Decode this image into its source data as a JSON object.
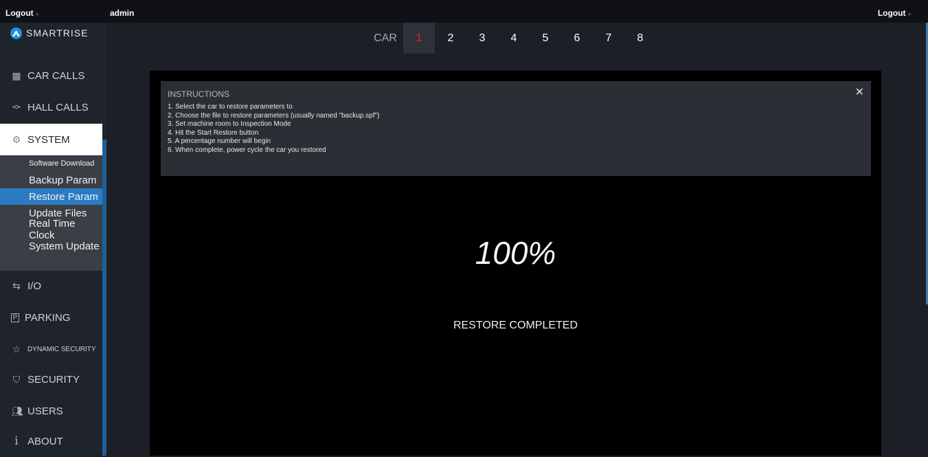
{
  "topbar": {
    "logout_left": "Logout",
    "user": "admin",
    "logout_right": "Logout"
  },
  "brand": {
    "name": "SMARTRISE"
  },
  "nav": {
    "car_calls": "CAR CALLS",
    "hall_calls": "HALL CALLS",
    "system": "SYSTEM",
    "io": "I/O",
    "parking": "PARKING",
    "dynamic_security": "DYNAMIC SECURITY",
    "security": "SECURITY",
    "users": "USERS",
    "about": "ABOUT"
  },
  "system_submenu": [
    "Software Download",
    "Backup Param",
    "Restore Param",
    "Update Files",
    "Real Time Clock",
    "System Update"
  ],
  "car_selector": {
    "label": "CAR",
    "cars": [
      "1",
      "2",
      "3",
      "4",
      "5",
      "6",
      "7",
      "8"
    ],
    "selected": "1"
  },
  "instructions": {
    "title": "INSTRUCTIONS",
    "lines": [
      "1. Select the car to restore parameters to",
      "2. Choose the file to restore parameters (usually named \"backup.spf\")",
      "3. Set machine room to Inspection Mode",
      "4. Hit the Start Restore button",
      "5. A percentage number will begin",
      "6. When complete, power cycle the car you restored"
    ]
  },
  "progress": {
    "percent_text": "100%",
    "status": "RESTORE COMPLETED"
  },
  "colors": {
    "accent": "#2a7bc2",
    "selected_car": "#e0262b",
    "brand_blue": "#1f8fe0"
  }
}
